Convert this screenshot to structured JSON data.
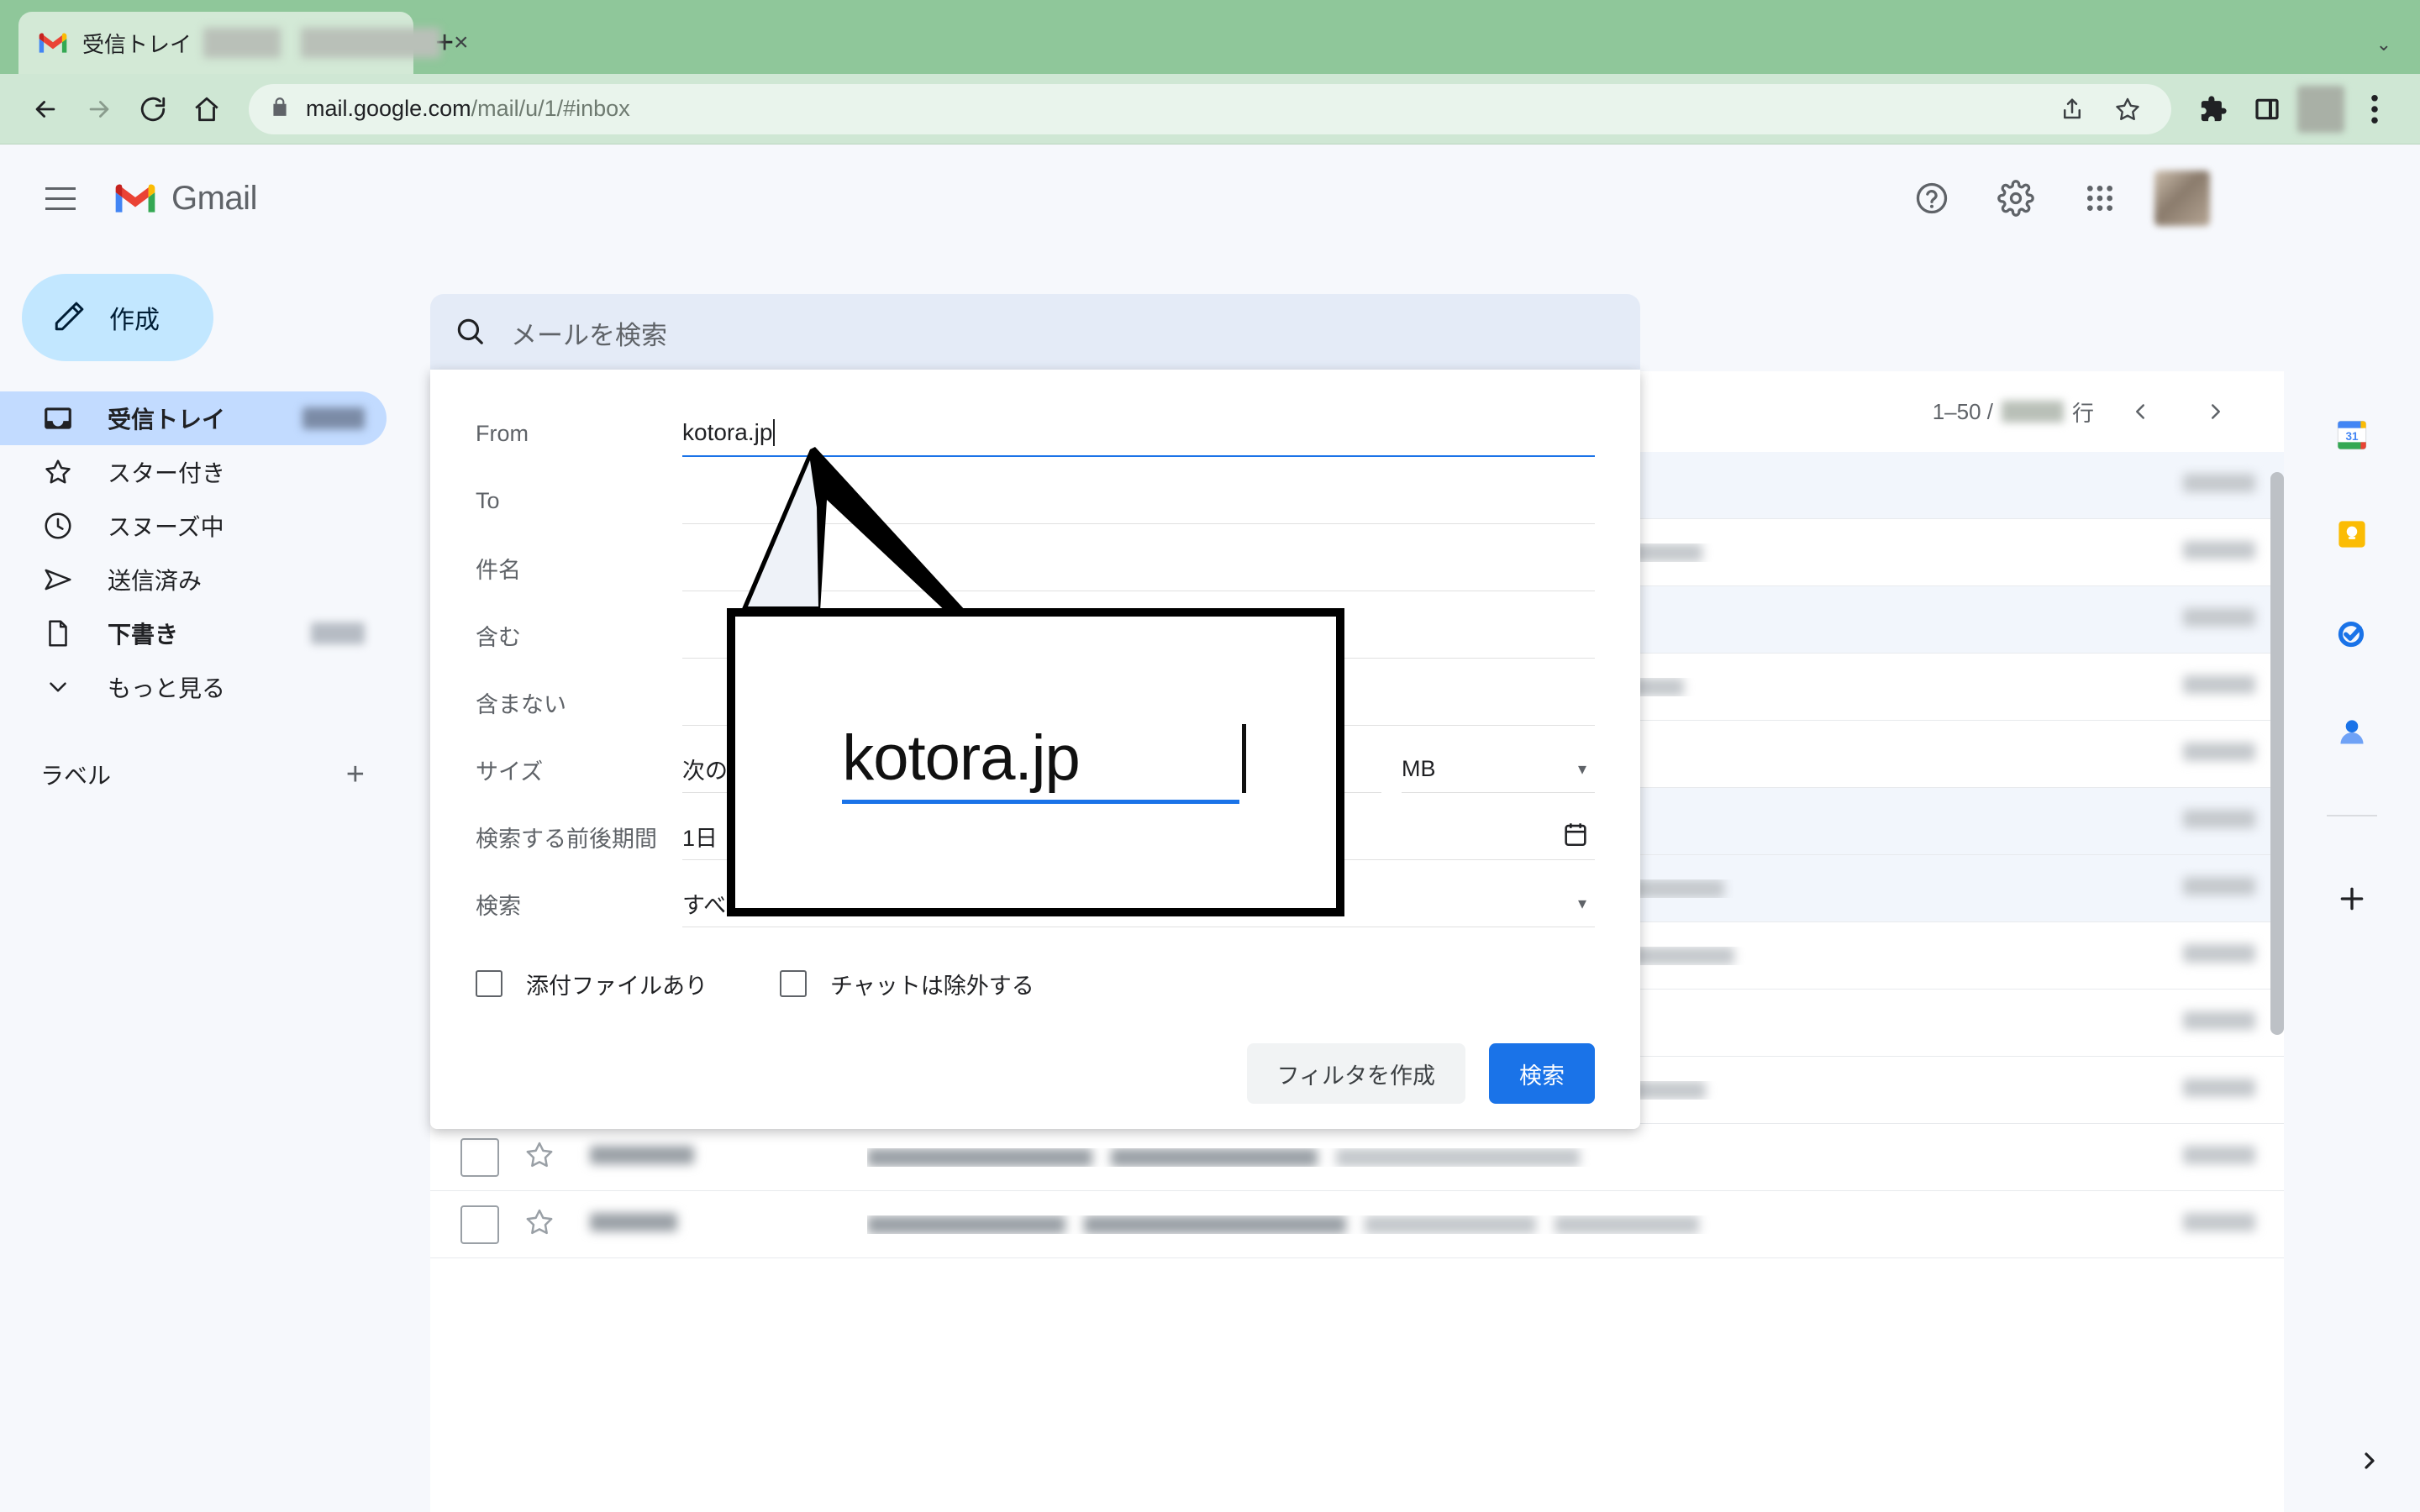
{
  "browser": {
    "tab": {
      "title_visible": "受信トレイ",
      "favicon": "gmail-favicon",
      "close_label": "×"
    },
    "new_tab_label": "+",
    "window_caret": "⌄",
    "nav": {
      "back_icon": "back-arrow-icon",
      "forward_icon": "forward-arrow-icon",
      "reload_icon": "reload-icon",
      "home_icon": "home-icon"
    },
    "omnibox": {
      "lock_icon": "lock-icon",
      "url_host": "mail.google.com",
      "url_path": "/mail/u/1/#inbox",
      "share_icon": "share-icon",
      "bookmark_icon": "star-outline-icon"
    },
    "extensions_icon": "puzzle-icon",
    "sidepanel_icon": "side-panel-icon",
    "menu_icon": "three-dot-menu-icon"
  },
  "gmail": {
    "menu_icon": "hamburger-icon",
    "logo_text": "Gmail",
    "search": {
      "icon": "search-icon",
      "placeholder": "メールを検索"
    },
    "header_actions": {
      "help": "help-icon",
      "settings": "gear-icon",
      "apps": "apps-grid-icon",
      "avatar": "avatar"
    },
    "sidebar": {
      "compose": {
        "label": "作成",
        "icon": "pencil-icon"
      },
      "items": [
        {
          "label": "受信トレイ",
          "icon": "inbox-icon",
          "active": true,
          "has_count": true
        },
        {
          "label": "スター付き",
          "icon": "star-icon",
          "active": false,
          "has_count": false
        },
        {
          "label": "スヌーズ中",
          "icon": "clock-icon",
          "active": false,
          "has_count": false
        },
        {
          "label": "送信済み",
          "icon": "send-icon",
          "active": false,
          "has_count": false
        },
        {
          "label": "下書き",
          "icon": "draft-icon",
          "active": false,
          "has_count": true
        },
        {
          "label": "もっと見る",
          "icon": "chevron-down-icon",
          "active": false,
          "has_count": false
        }
      ],
      "labels": {
        "title": "ラベル",
        "add_label": "+"
      }
    },
    "list": {
      "pagination": {
        "range": "1–50 /",
        "suffix": "行",
        "prev_icon": "chevron-left-icon",
        "next_icon": "chevron-right-icon"
      },
      "rows": [
        {
          "unread": true,
          "sender_w": 108,
          "subj": [
            320,
            300,
            240
          ],
          "date_w": 86
        },
        {
          "unread": false,
          "sender_w": 82,
          "subj": [
            232,
            288,
            198,
            210
          ],
          "date_w": 86
        },
        {
          "unread": true,
          "sender_w": 136,
          "subj": [
            250,
            312,
            180
          ],
          "date_w": 86
        },
        {
          "unread": false,
          "sender_w": 118,
          "subj": [
            284,
            252,
            204,
            166
          ],
          "date_w": 86
        },
        {
          "unread": false,
          "sender_w": 96,
          "subj": [
            206,
            330,
            264
          ],
          "date_w": 86
        },
        {
          "unread": true,
          "sender_w": 142,
          "subj": [
            268,
            290,
            212
          ],
          "date_w": 86
        },
        {
          "unread": true,
          "sender_w": 126,
          "subj": [
            300,
            226,
            188,
            240
          ],
          "date_w": 86
        },
        {
          "unread": false,
          "sender_w": 74,
          "subj": [
            232,
            258,
            176,
            300
          ],
          "date_w": 86
        },
        {
          "unread": false,
          "sender_w": 162,
          "subj": [
            244,
            298,
            222
          ],
          "date_w": 86
        },
        {
          "unread": false,
          "sender_w": 92,
          "subj": [
            212,
            344,
            196,
            180
          ],
          "date_w": 86
        },
        {
          "unread": false,
          "sender_w": 124,
          "subj": [
            268,
            246,
            290
          ],
          "date_w": 86
        },
        {
          "unread": false,
          "sender_w": 104,
          "subj": [
            236,
            312,
            204,
            172
          ],
          "date_w": 86
        }
      ]
    },
    "rail": {
      "items": [
        {
          "icon": "google-calendar-icon",
          "name": "calendar"
        },
        {
          "icon": "google-keep-icon",
          "name": "keep"
        },
        {
          "icon": "google-tasks-icon",
          "name": "tasks"
        },
        {
          "icon": "google-contacts-icon",
          "name": "contacts"
        }
      ],
      "add_label": "+",
      "expand_icon": "chevron-right-icon"
    },
    "search_panel": {
      "fields": [
        {
          "label": "From",
          "value": "kotora.jp",
          "focused": true
        },
        {
          "label": "To",
          "value": "",
          "focused": false
        },
        {
          "label": "件名",
          "value": "",
          "focused": false
        },
        {
          "label": "含む",
          "value": "",
          "focused": false
        },
        {
          "label": "含まない",
          "value": "",
          "focused": false
        }
      ],
      "size": {
        "label": "サイズ",
        "operator": "次の値より大きい",
        "value": "",
        "unit": "MB"
      },
      "date": {
        "label": "検索する前後期間",
        "period": "1日",
        "value": "",
        "calendar_icon": "calendar-icon"
      },
      "scope": {
        "label": "検索",
        "value": "すべてのメール"
      },
      "checkboxes": [
        {
          "label": "添付ファイルあり",
          "checked": false
        },
        {
          "label": "チャットは除外する",
          "checked": false
        }
      ],
      "buttons": {
        "create_filter": "フィルタを作成",
        "search": "検索"
      }
    }
  },
  "annotation": {
    "callout_text": "kotora.jp"
  },
  "colors": {
    "browser_chrome": "#8fc79a",
    "browser_toolbar": "#cfe7d4",
    "gmail_bg": "#f6f8fc",
    "compose_bg": "#c2e7ff",
    "nav_active_bg": "#c2dbff",
    "search_bg": "#e4ebf7",
    "primary_button": "#1a73e8",
    "focus_underline": "#1a73e8"
  }
}
